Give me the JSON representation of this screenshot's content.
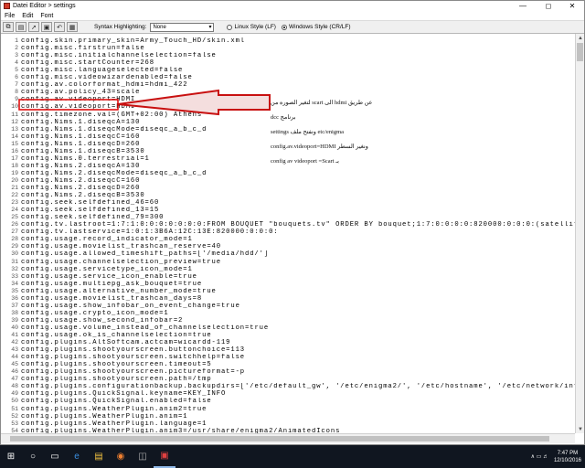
{
  "window": {
    "title": "Datei Editor > settings"
  },
  "menu": [
    "File",
    "Edit",
    "Font"
  ],
  "toolbar": {
    "syntax_label": "Syntax Highlighting:",
    "syntax_value": "None",
    "radio1": "Linux Style (LF)",
    "radio2": "Windows Style (CR/LF)"
  },
  "lines": [
    "config.skin.primary_skin=Army_Touch_HD/skin.xml",
    "config.misc.firstrun=false",
    "config.misc.initialchannelselection=false",
    "config.misc.startCounter=268",
    "config.misc.languageselected=false",
    "config.misc.videowizardenabled=false",
    "config.av.colorformat_hdmi=hdmi_422",
    "config.av.policy_43=scale",
    "config.av.videoport=HDMI",
    "config.av.videoport=HDMI",
    "config.timezone.val=(GMT+02:00) Athens",
    "config.Nims.1.diseqcA=130",
    "config.Nims.1.diseqcMode=diseqc_a_b_c_d",
    "config.Nims.1.diseqcC=160",
    "config.Nims.1.diseqcD=260",
    "config.Nims.1.diseqcB=3530",
    "config.Nims.0.terrestrial=1",
    "config.Nims.2.diseqcA=130",
    "config.Nims.2.diseqcMode=diseqc_a_b_c_d",
    "config.Nims.2.diseqcC=160",
    "config.Nims.2.diseqcD=260",
    "config.Nims.2.diseqcB=3530",
    "config.seek.selfdefined_46=60",
    "config.seek.selfdefined_13=15",
    "config.seek.selfdefined_79=300",
    "config.tv.lastroot=1:7:1:0:0:0:0:0:0:0:FROM BOUQUET \"bouquets.tv\" ORDER BY bouquet;1:7:0:0:0:0:820000:0:0:0:(satellitePos",
    "config.tv.lastservice=1:0:1:3B6A:12C:13E:820000:0:0:0:",
    "config.usage.record_indicator_mode=1",
    "config.usage.movielist_trashcan_reserve=40",
    "config.usage.allowed_timeshift_paths=['/media/hdd/']",
    "config.usage.channelselection_preview=true",
    "config.usage.servicetype_icon_mode=1",
    "config.usage.service_icon_enable=true",
    "config.usage.multiepg_ask_bouquet=true",
    "config.usage.alternative_number_mode=true",
    "config.usage.movielist_trashcan_days=8",
    "config.usage.show_infobar_on_event_change=true",
    "config.usage.crypto_icon_mode=1",
    "config.usage.show_second_infobar=2",
    "config.usage.volume_instead_of_channelselection=true",
    "config.usage.ok_is_channelselection=true",
    "config.plugins.AltSoftcam.actcam=wicardd-119",
    "config.plugins.shootyourscreen.buttonchoice=113",
    "config.plugins.shootyourscreen.switchhelp=false",
    "config.plugins.shootyourscreen.timeout=5",
    "config.plugins.shootyourscreen.pictureformat=-p",
    "config.plugins.shootyourscreen.path=/tmp",
    "config.plugins.configurationbackup.backupdirs=['/etc/default_gw', '/etc/enigma2/', '/etc/hostname', '/etc/network/interfa",
    "config.plugins.QuickSignal.keyname=KEY_INFO",
    "config.plugins.QuickSignal.enabled=false",
    "config.plugins.WeatherPlugin.anim2=true",
    "config.plugins.WeatherPlugin.anim=1",
    "config.plugins.WeatherPlugin.language=1",
    "config.plugins.WeatherPlugin.anim3=/usr/share/enigma2/AnimatedIcons"
  ],
  "note": [
    "عن طريق hdmi الى scart لتغير الصوره من",
    "برنامج dcc",
    "etc/enigma ونفتح ملف settings",
    "ونغير السطر config.av.videoport=HDMI",
    "بـ config av videoport =Scart"
  ],
  "taskbar": {
    "time": "7:47 PM",
    "date": "12/10/2016"
  }
}
